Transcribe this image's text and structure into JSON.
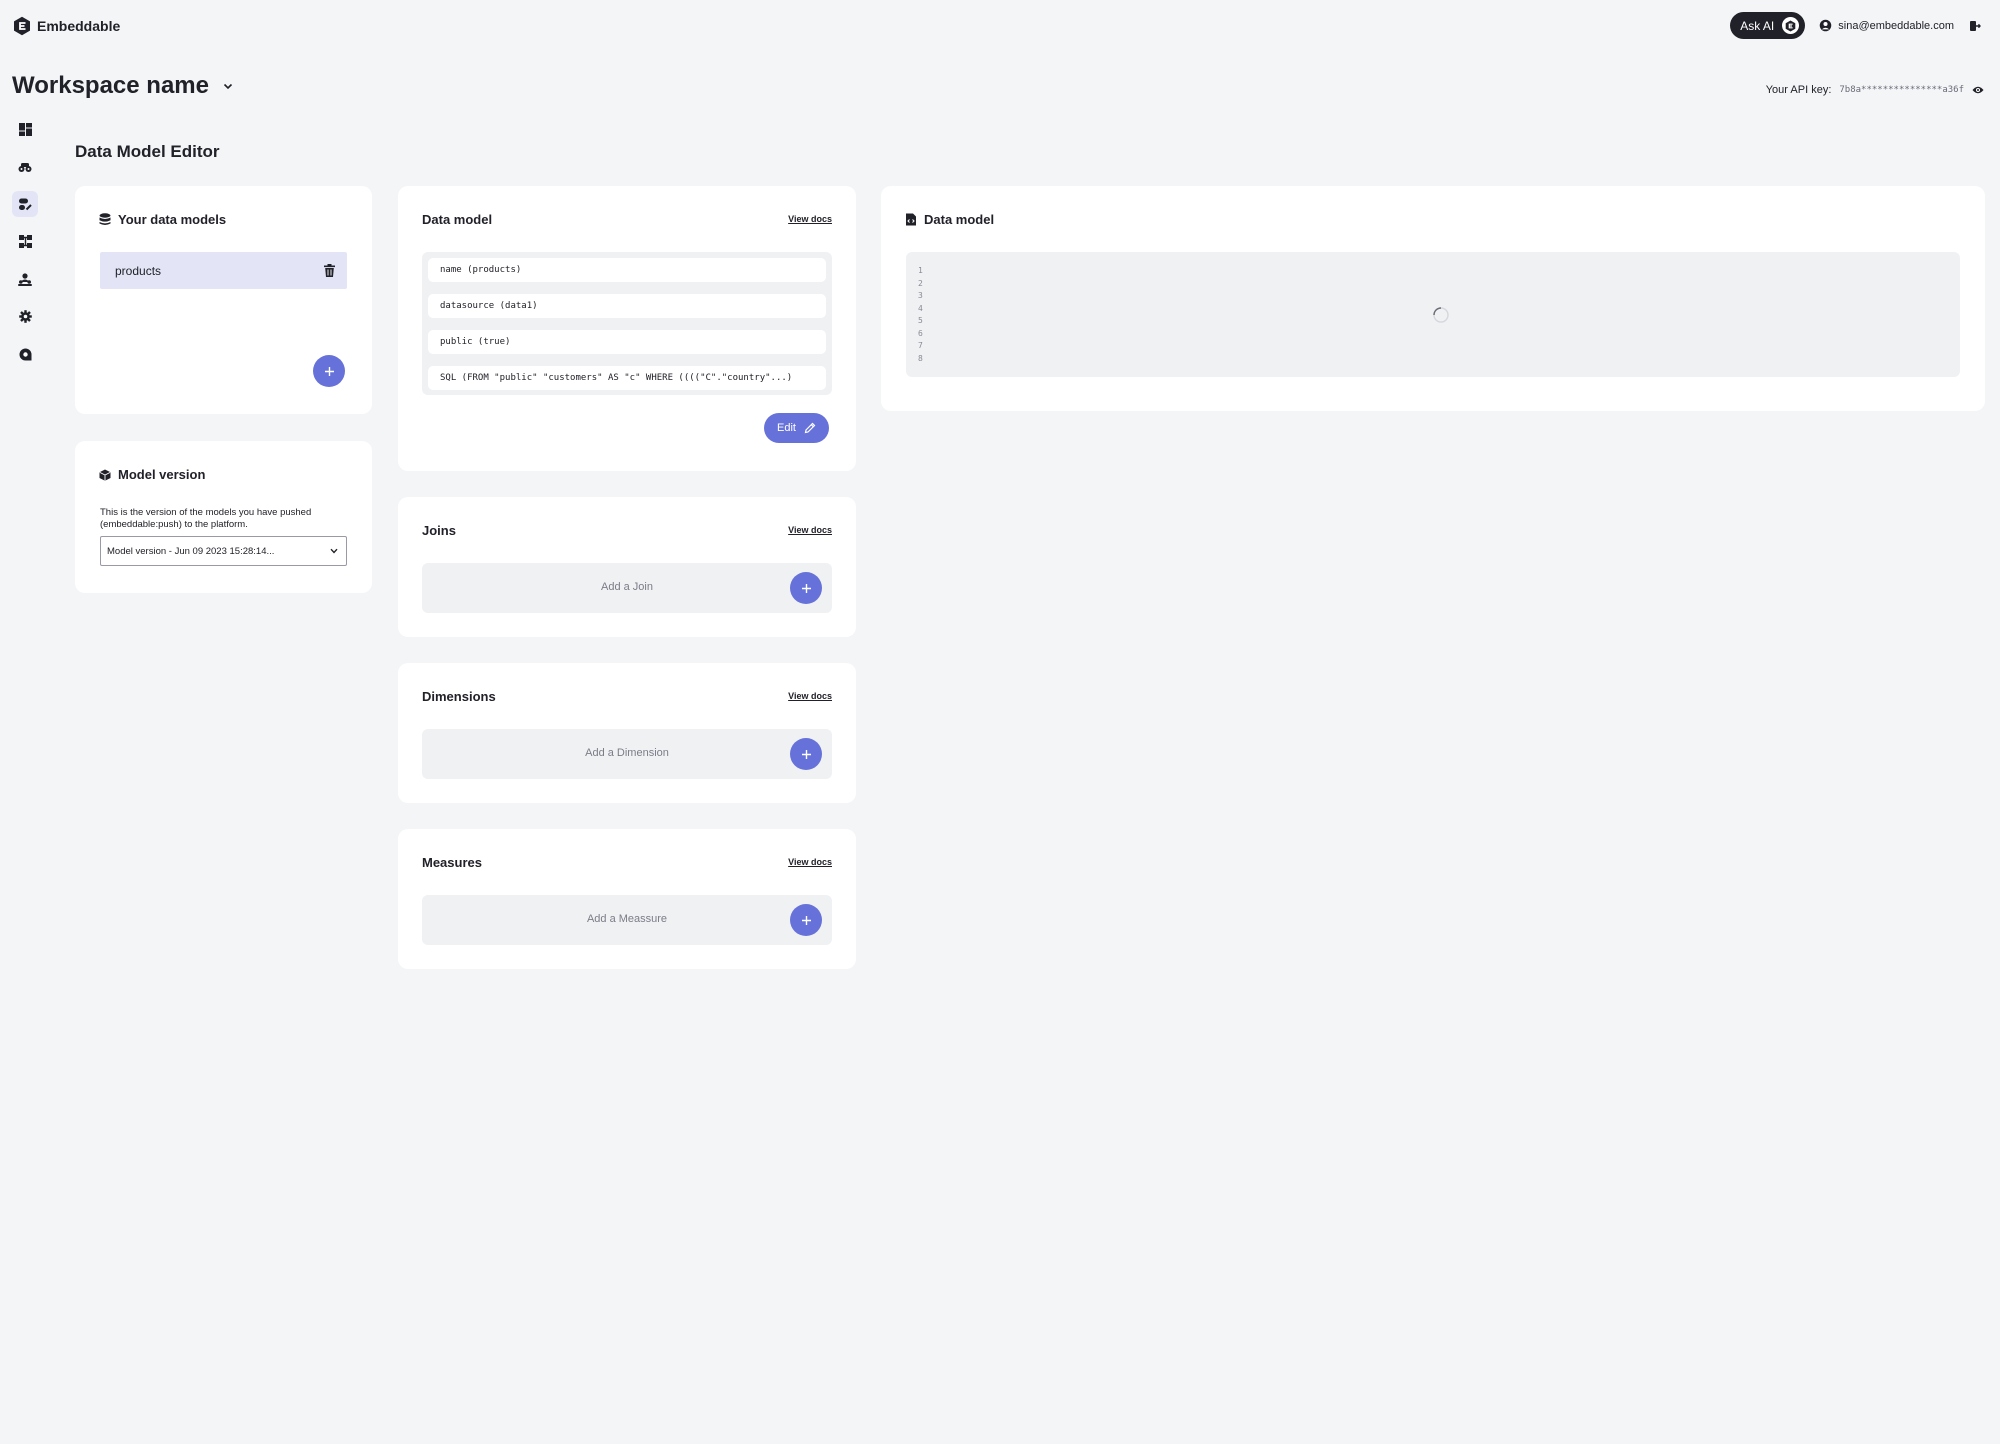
{
  "header": {
    "brand": "Embeddable",
    "ask_ai_label": "Ask AI",
    "user_email": "sina@embeddable.com"
  },
  "workspace": {
    "name": "Workspace name",
    "api_key_label": "Your API key:",
    "api_key_value": "7b8a***************a36f"
  },
  "sidebar": {
    "items": [
      {
        "icon": "dashboard-icon"
      },
      {
        "icon": "components-icon"
      },
      {
        "icon": "data-models-icon",
        "active": true
      },
      {
        "icon": "connections-icon"
      },
      {
        "icon": "team-icon"
      },
      {
        "icon": "settings-icon"
      },
      {
        "icon": "support-icon"
      }
    ]
  },
  "page": {
    "title": "Data Model Editor"
  },
  "data_models": {
    "title": "Your data models",
    "items": [
      {
        "name": "products"
      }
    ]
  },
  "model_version": {
    "title": "Model version",
    "description": "This is the version of the models you have pushed (embeddable:push) to the platform.",
    "selected": "Model version - Jun 09 2023 15:28:14..."
  },
  "data_model_props": {
    "title": "Data model",
    "view_docs": "View docs",
    "rows": [
      "name (products)",
      "datasource (data1)",
      "public (true)",
      "SQL (FROM \"public\" \"customers\" AS \"c\" WHERE ((((\"C\".\"country\"...)"
    ],
    "edit_label": "Edit"
  },
  "joins": {
    "title": "Joins",
    "view_docs": "View docs",
    "add_label": "Add a Join"
  },
  "dimensions": {
    "title": "Dimensions",
    "view_docs": "View docs",
    "add_label": "Add a Dimension"
  },
  "measures": {
    "title": "Measures",
    "view_docs": "View docs",
    "add_label": "Add a Meassure"
  },
  "code_view": {
    "title": "Data model",
    "line_numbers": [
      "1",
      "2",
      "3",
      "4",
      "5",
      "6",
      "7",
      "8"
    ]
  },
  "colors": {
    "accent": "#6672d9",
    "selected_bg": "#e3e5f7",
    "background": "#f4f5f7",
    "dark": "#212129"
  }
}
